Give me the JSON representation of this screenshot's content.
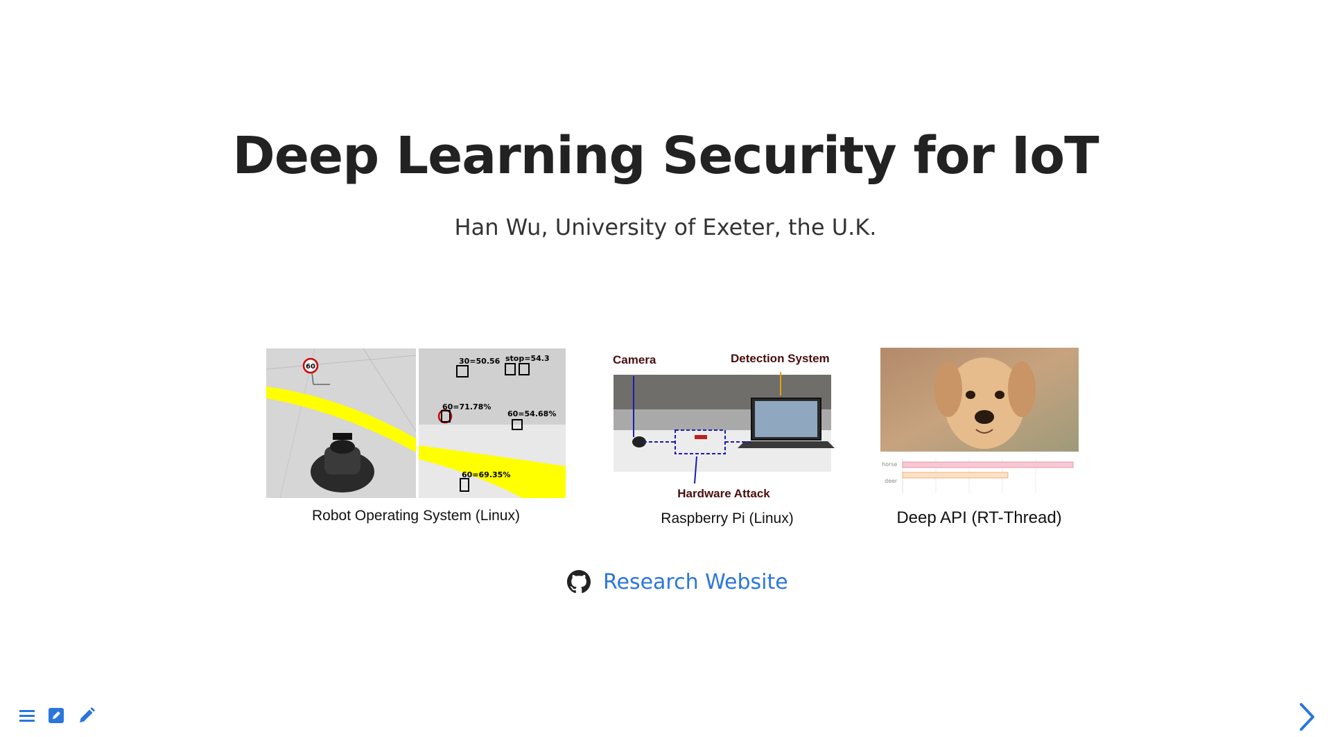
{
  "title": "Deep Learning Security for IoT",
  "subtitle": "Han Wu, University of Exeter, the U.K.",
  "figures": [
    {
      "caption": "Robot Operating System (Linux)",
      "labels": {
        "sign": "60",
        "d1": "30=50.56",
        "d2": "stop=54.3",
        "d3": "60=71.78%",
        "d4": "60=54.68%",
        "d5": "60=69.35%"
      }
    },
    {
      "caption": "Raspberry Pi (Linux)",
      "labels": {
        "camera": "Camera",
        "detection": "Detection System",
        "attack": "Hardware Attack"
      }
    },
    {
      "caption": "Deep API (RT-Thread)",
      "labels": {
        "horse": "horse",
        "deer": "deer"
      }
    }
  ],
  "link": {
    "icon": "github-icon",
    "label": "Research Website"
  },
  "toolbar": {
    "icons": [
      "menu-icon",
      "edit-square-icon",
      "pencil-icon"
    ]
  },
  "nav": {
    "next_icon": "chevron-right-icon"
  },
  "colors": {
    "accent": "#2a76dd",
    "highlight": "#ffff00"
  }
}
